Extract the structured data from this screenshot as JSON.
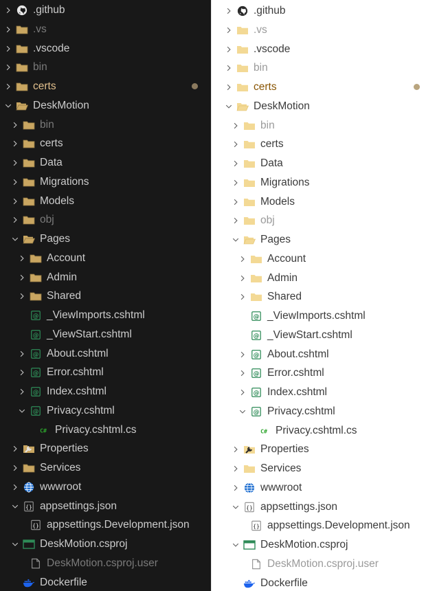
{
  "colors": {
    "dark_bg": "#181818",
    "dark_text": "#cccccc",
    "dark_dim": "#7a7a7a",
    "dark_folder": "#c9a661",
    "light_bg": "#ffffff",
    "light_text": "#3b3b3b",
    "light_folder": "#f3d995",
    "razor_green": "#2e8b57",
    "csharp_green": "#2da52d",
    "globe_blue": "#1f6fd1",
    "docker_blue": "#1d63ed",
    "modified_accent": "#e2c08d"
  },
  "tree": [
    {
      "label": ".github",
      "depth": 0,
      "chevron": "right",
      "icon": "github-icon"
    },
    {
      "label": ".vs",
      "depth": 0,
      "chevron": "right",
      "icon": "folder-icon",
      "dim": true
    },
    {
      "label": ".vscode",
      "depth": 0,
      "chevron": "right",
      "icon": "folder-icon"
    },
    {
      "label": "bin",
      "depth": 0,
      "chevron": "right",
      "icon": "folder-icon",
      "dim": true
    },
    {
      "label": "certs",
      "depth": 0,
      "chevron": "right",
      "icon": "folder-icon",
      "modified": true
    },
    {
      "label": "DeskMotion",
      "depth": 0,
      "chevron": "down",
      "icon": "folder-open-icon"
    },
    {
      "label": "bin",
      "depth": 1,
      "chevron": "right",
      "icon": "folder-icon",
      "dim": true
    },
    {
      "label": "certs",
      "depth": 1,
      "chevron": "right",
      "icon": "folder-icon"
    },
    {
      "label": "Data",
      "depth": 1,
      "chevron": "right",
      "icon": "folder-icon"
    },
    {
      "label": "Migrations",
      "depth": 1,
      "chevron": "right",
      "icon": "folder-icon"
    },
    {
      "label": "Models",
      "depth": 1,
      "chevron": "right",
      "icon": "folder-icon"
    },
    {
      "label": "obj",
      "depth": 1,
      "chevron": "right",
      "icon": "folder-icon",
      "dim": true
    },
    {
      "label": "Pages",
      "depth": 1,
      "chevron": "down",
      "icon": "folder-open-icon"
    },
    {
      "label": "Account",
      "depth": 2,
      "chevron": "right",
      "icon": "folder-icon"
    },
    {
      "label": "Admin",
      "depth": 2,
      "chevron": "right",
      "icon": "folder-icon"
    },
    {
      "label": "Shared",
      "depth": 2,
      "chevron": "right",
      "icon": "folder-icon"
    },
    {
      "label": "_ViewImports.cshtml",
      "depth": 2,
      "chevron": "none",
      "icon": "razor-file-icon"
    },
    {
      "label": "_ViewStart.cshtml",
      "depth": 2,
      "chevron": "none",
      "icon": "razor-file-icon"
    },
    {
      "label": "About.cshtml",
      "depth": 2,
      "chevron": "right",
      "icon": "razor-file-icon"
    },
    {
      "label": "Error.cshtml",
      "depth": 2,
      "chevron": "right",
      "icon": "razor-file-icon"
    },
    {
      "label": "Index.cshtml",
      "depth": 2,
      "chevron": "right",
      "icon": "razor-file-icon"
    },
    {
      "label": "Privacy.cshtml",
      "depth": 2,
      "chevron": "down",
      "icon": "razor-file-icon"
    },
    {
      "label": "Privacy.cshtml.cs",
      "depth": 3,
      "chevron": "none",
      "icon": "csharp-file-icon"
    },
    {
      "label": "Properties",
      "depth": 1,
      "chevron": "right",
      "icon": "wrench-folder-icon"
    },
    {
      "label": "Services",
      "depth": 1,
      "chevron": "right",
      "icon": "folder-icon"
    },
    {
      "label": "wwwroot",
      "depth": 1,
      "chevron": "right",
      "icon": "globe-icon"
    },
    {
      "label": "appsettings.json",
      "depth": 1,
      "chevron": "down",
      "icon": "json-file-icon"
    },
    {
      "label": "appsettings.Development.json",
      "depth": 2,
      "chevron": "none",
      "icon": "json-file-icon"
    },
    {
      "label": "DeskMotion.csproj",
      "depth": 1,
      "chevron": "down",
      "icon": "csproj-icon"
    },
    {
      "label": "DeskMotion.csproj.user",
      "depth": 2,
      "chevron": "none",
      "icon": "file-icon",
      "dim": true
    },
    {
      "label": "Dockerfile",
      "depth": 1,
      "chevron": "none",
      "icon": "docker-icon"
    }
  ]
}
